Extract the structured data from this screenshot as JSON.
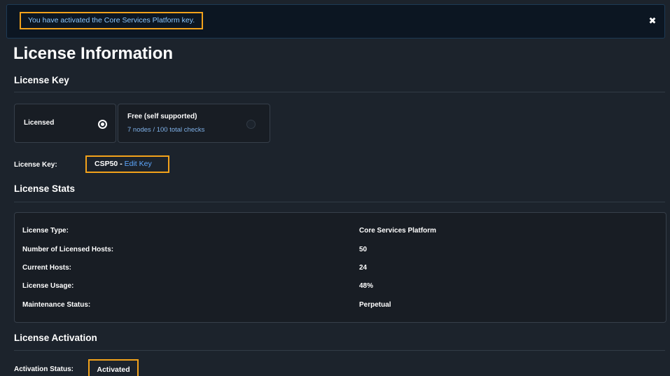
{
  "alert": {
    "message": "You have activated the Core Services Platform key.",
    "close_glyph": "✖"
  },
  "page_title": "License Information",
  "license_key_section": {
    "title": "License Key",
    "options": [
      {
        "label": "Licensed",
        "sublabel": "",
        "selected": true
      },
      {
        "label": "Free (self supported)",
        "sublabel": "7 nodes / 100 total checks",
        "selected": false
      }
    ],
    "key_label": "License Key:",
    "key_value": "CSP50",
    "key_separator": " - ",
    "edit_link": "Edit Key"
  },
  "license_stats": {
    "title": "License Stats",
    "rows": [
      {
        "label": "License Type:",
        "value": "Core Services Platform"
      },
      {
        "label": "Number of Licensed Hosts:",
        "value": "50"
      },
      {
        "label": "Current Hosts:",
        "value": "24"
      },
      {
        "label": "License Usage:",
        "value": "48%"
      },
      {
        "label": "Maintenance Status:",
        "value": "Perpetual"
      }
    ]
  },
  "license_activation": {
    "title": "License Activation",
    "status_label": "Activation Status:",
    "status_value": "Activated"
  },
  "colors": {
    "background": "#1c232c",
    "panel": "#181d24",
    "highlight": "#f2a21b",
    "link": "#5ea8ff",
    "alert_text": "#8ec9ff"
  }
}
